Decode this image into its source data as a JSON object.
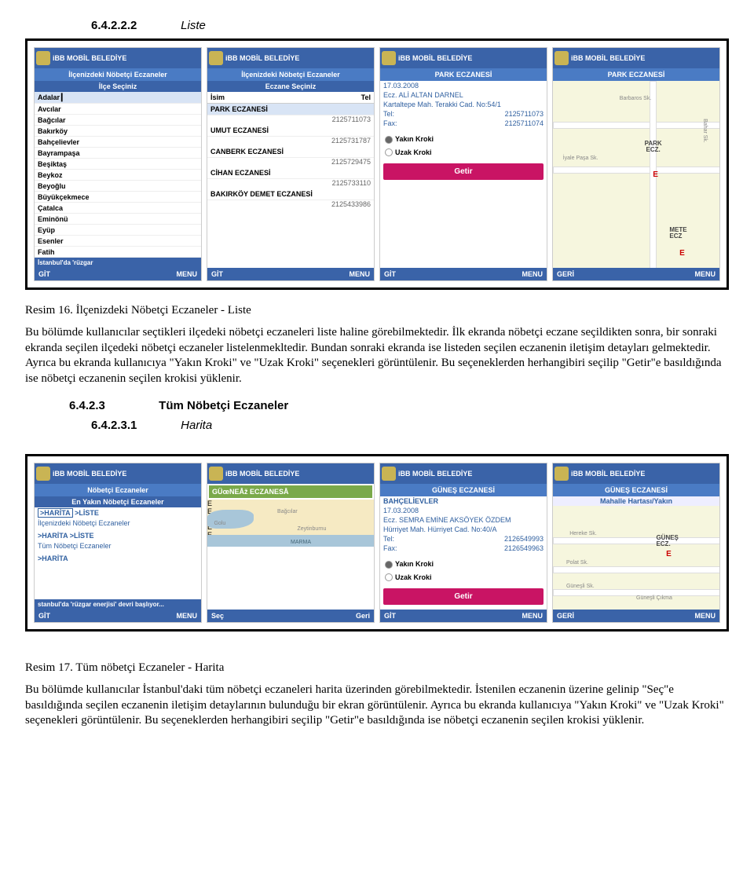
{
  "section1": {
    "num": "6.4.2.2.2",
    "title": "Liste"
  },
  "fig1": {
    "caption": "Resim 16. İlçenizdeki Nöbetçi Eczaneler - Liste",
    "body": "Bu bölümde kullanıcılar seçtikleri ilçedeki nöbetçi eczaneleri liste haline görebilmektedir. İlk ekranda nöbetçi eczane seçildikten sonra, bir sonraki ekranda seçilen ilçedeki nöbetçi eczaneler listelenmekltedir. Bundan sonraki ekranda ise listeden seçilen eczanenin iletişim detayları gelmektedir. Ayrıca bu ekranda kullanıcıya \"Yakın Kroki\" ve \"Uzak Kroki\" seçenekleri görüntülenir. Bu seçeneklerden herhangibiri seçilip \"Getir\"e basıldığında ise nöbetçi eczanenin seçilen krokisi yüklenir."
  },
  "section2": {
    "num": "6.4.2.3",
    "title": "Tüm Nöbetçi Eczaneler"
  },
  "section3": {
    "num": "6.4.2.3.1",
    "title": "Harita"
  },
  "fig2": {
    "caption": "Resim 17. Tüm nöbetçi Eczaneler - Harita",
    "body": "Bu bölümde kullanıcılar İstanbul'daki tüm nöbetçi eczaneleri harita üzerinden görebilmektedir. İstenilen eczanenin üzerine gelinip \"Seç\"e basıldığında seçilen eczanenin iletişim detaylarının bulunduğu bir ekran görüntülenir. Ayrıca bu ekranda kullanıcıya \"Yakın Kroki\" ve \"Uzak Kroki\" seçenekleri görüntülenir. Bu seçeneklerden herhangibiri seçilip \"Getir\"e basıldığında ise nöbetçi eczanenin seçilen krokisi yüklenir."
  },
  "mobile": {
    "brand": "iBB MOBİL BELEDİYE",
    "sk_git": "GİT",
    "sk_menu": "MENU",
    "sk_geri": "GERİ",
    "sk_sec": "Seç",
    "newsA": "İstanbul'da 'rüzgar"
  },
  "phoneA": {
    "title": "İlçenizdeki Nöbetçi Eczaneler",
    "sub": "İlçe Seçiniz",
    "items": [
      "Adalar",
      "Avcılar",
      "Bağcılar",
      "Bakırköy",
      "Bahçelievler",
      "Bayrampaşa",
      "Beşiktaş",
      "Beykoz",
      "Beyoğlu",
      "Büyükçekmece",
      "Çatalca",
      "Eminönü",
      "Eyüp",
      "Esenler",
      "Fatih"
    ]
  },
  "phoneB": {
    "title": "İlçenizdeki Nöbetçi Eczaneler",
    "sub": "Eczane Seçiniz",
    "col1": "İsim",
    "col2": "Tel",
    "rows": [
      {
        "name": "PARK ECZANESİ",
        "tel": "2125711073"
      },
      {
        "name": "UMUT ECZANESİ",
        "tel": "2125731787"
      },
      {
        "name": "CANBERK ECZANESİ",
        "tel": "2125729475"
      },
      {
        "name": "CİHAN ECZANESİ",
        "tel": "2125733110"
      },
      {
        "name": "BAKIRKÖY DEMET ECZANESİ",
        "tel": "2125433986"
      }
    ]
  },
  "phoneC": {
    "title": "PARK ECZANESİ",
    "date": "17.03.2008",
    "name": "Ecz. ALİ ALTAN DARNEL",
    "addr": "Kartaltepe Mah. Terakki Cad. No:54/1",
    "tel_lab": "Tel:",
    "tel": "2125711073",
    "fax_lab": "Fax:",
    "fax": "2125711074",
    "r1": "Yakın Kroki",
    "r2": "Uzak Kroki",
    "btn": "Getir"
  },
  "phoneD": {
    "title": "PARK ECZANESİ",
    "streets": [
      "Barbaros Sk.",
      "Bahar Sk.",
      "İyale Paşa Sk."
    ],
    "park": "PARK\\nECZ.",
    "e": "E",
    "mete": "METE\\nECZ"
  },
  "phoneE": {
    "title": "Nöbetçi Eczaneler",
    "sub": "En Yakın Nöbetçi Eczaneler",
    "l1a": ">HARİTA",
    "l1b": ">LİSTE",
    "cat1": "İlçenizdeki Nöbetçi Eczaneler",
    "l2a": ">HARİTA",
    "l2b": ">LİSTE",
    "cat2": "Tüm Nöbetçi Eczaneler",
    "l3": ">HARİTA",
    "news": "stanbul'da 'rüzgar enerjisi' devri başlıyor..."
  },
  "phoneF": {
    "sel": "GÜœNEÅž ECZANESÅ",
    "labels": [
      "Bağcılar",
      "Zeytinburnu",
      "Golu",
      "MARMA"
    ]
  },
  "phoneG": {
    "title": "GÜNEŞ ECZANESİ",
    "district": "BAHÇELİEVLER",
    "date": "17.03.2008",
    "name": "Ecz. SEMRA EMİNE AKSÖYEK ÖZDEM",
    "addr": "Hürriyet Mah. Hürriyet Cad. No:40/A",
    "tel_lab": "Tel:",
    "tel": "2126549993",
    "fax_lab": "Fax:",
    "fax": "2126549963",
    "r1": "Yakın Kroki",
    "r2": "Uzak Kroki",
    "btn": "Getir"
  },
  "phoneH": {
    "title": "GÜNEŞ ECZANESİ",
    "sub": "Mahalle Hartası/Yakın",
    "streets": [
      "Hereke Sk.",
      "Polat Sk.",
      "Güneşli Sk.",
      "Güneşli Çıkma"
    ],
    "g": "GÜNEŞ\\nECZ.",
    "e": "E"
  }
}
